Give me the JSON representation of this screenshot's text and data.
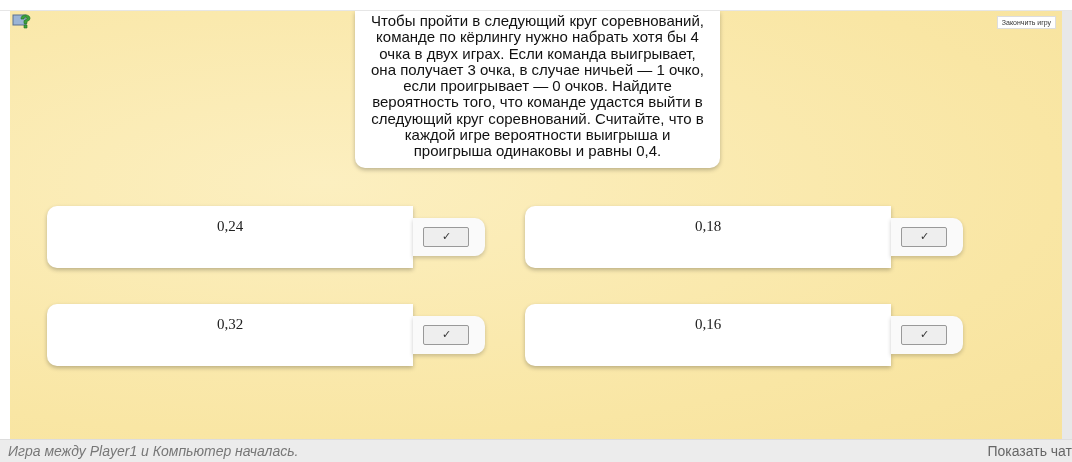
{
  "toolbar": {
    "finish_button": "Закончить игру"
  },
  "question": "Чтобы пройти в следующий круг соревнований, команде по кёрлингу нужно набрать хотя бы 4 очка в двух играх. Если команда выигрывает, она получает 3 очка, в случае ничьей — 1 очко, если проигрывает — 0 очков. Найдите вероятность того, что команде удастся выйти в следующий круг соревнований. Считайте, что в каждой игре вероятности выигрыша и проигрыша одинаковы и равны 0,4.",
  "answers": [
    {
      "value": "0,24",
      "check": "✓"
    },
    {
      "value": "0,18",
      "check": "✓"
    },
    {
      "value": "0,32",
      "check": "✓"
    },
    {
      "value": "0,16",
      "check": "✓"
    }
  ],
  "status_bar": {
    "message": "Игра между Player1 и Компьютер началась.",
    "chat_link": "Показать чат"
  }
}
